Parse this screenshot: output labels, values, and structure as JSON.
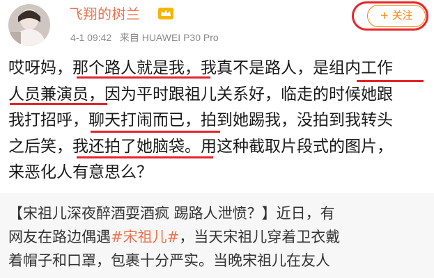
{
  "header": {
    "username": "飞翔的树兰",
    "badge_icon": "vip-crown-badge-icon",
    "meta": "4-1 09:42   来自 HUAWEI P30 Pro",
    "follow_label": "+ 关注"
  },
  "post": {
    "lines": [
      "哎呀妈，那个路人就是我，我真不是路人，是组内工作",
      "人员兼演员，因为平时跟祖儿关系好，临走的时候她跟",
      "我打招呼，聊天打闹而已，拍到她踢我，没拍到我转头",
      "之后笑，我还拍了她脑袋。用这种截取片段式的图片，",
      "来恶化人有意思么？"
    ]
  },
  "quoted": {
    "line1": "【宋祖儿深夜醉酒耍酒疯 踢路人泄愤？】近日，有",
    "line2_a": "网友在路边偶遇",
    "line2_topic": "#宋祖儿#",
    "line2_b": "，当天宋祖儿穿着卫衣戴",
    "line3": "着帽子和口罩，包裹十分严实。当晚宋祖儿在友人"
  },
  "colors": {
    "username": "#eb7350",
    "follow": "#ff8200",
    "annotation_red": "#e2242c"
  }
}
